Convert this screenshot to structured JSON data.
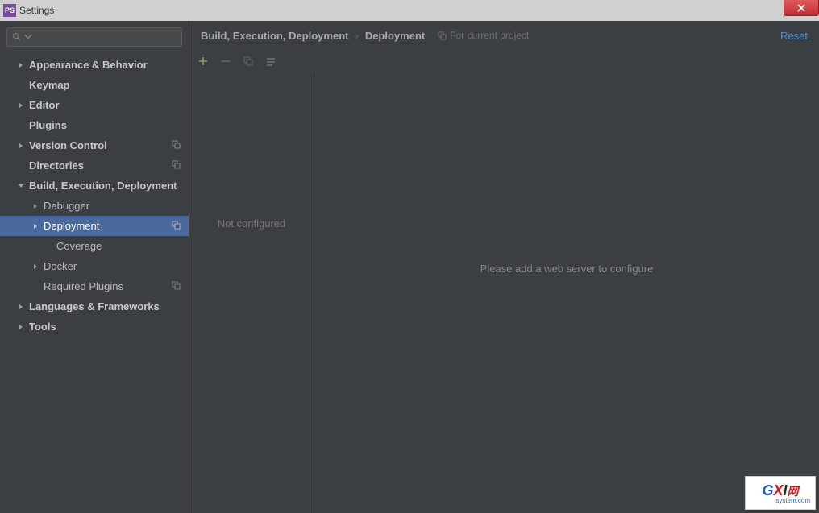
{
  "titlebar": {
    "app_icon": "PS",
    "title": "Settings"
  },
  "sidebar": {
    "search_placeholder": "",
    "items": [
      {
        "label": "Appearance & Behavior",
        "level": 1,
        "chevron": "right",
        "bold": true
      },
      {
        "label": "Keymap",
        "level": 1,
        "bold": true
      },
      {
        "label": "Editor",
        "level": 1,
        "chevron": "right",
        "bold": true
      },
      {
        "label": "Plugins",
        "level": 1,
        "bold": true
      },
      {
        "label": "Version Control",
        "level": 1,
        "chevron": "right",
        "bold": true,
        "badge": true
      },
      {
        "label": "Directories",
        "level": 1,
        "bold": true,
        "badge": true
      },
      {
        "label": "Build, Execution, Deployment",
        "level": 1,
        "chevron": "down",
        "bold": true
      },
      {
        "label": "Debugger",
        "level": 2,
        "chevron": "right"
      },
      {
        "label": "Deployment",
        "level": 2,
        "chevron": "right",
        "selected": true,
        "badge": true
      },
      {
        "label": "Coverage",
        "level": 3
      },
      {
        "label": "Docker",
        "level": 2,
        "chevron": "right"
      },
      {
        "label": "Required Plugins",
        "level": 2,
        "badge": true
      },
      {
        "label": "Languages & Frameworks",
        "level": 1,
        "chevron": "right",
        "bold": true
      },
      {
        "label": "Tools",
        "level": 1,
        "chevron": "right",
        "bold": true
      }
    ]
  },
  "breadcrumb": {
    "items": [
      "Build, Execution, Deployment",
      "Deployment"
    ],
    "hint": "For current project",
    "reset": "Reset"
  },
  "toolbar": {
    "add": "+",
    "remove": "−"
  },
  "panes": {
    "left_empty": "Not configured",
    "right_empty": "Please add a web server to configure"
  },
  "watermark": {
    "g": "G",
    "x": "X",
    "i": "I",
    "w": "网",
    "sub": "system.com"
  }
}
